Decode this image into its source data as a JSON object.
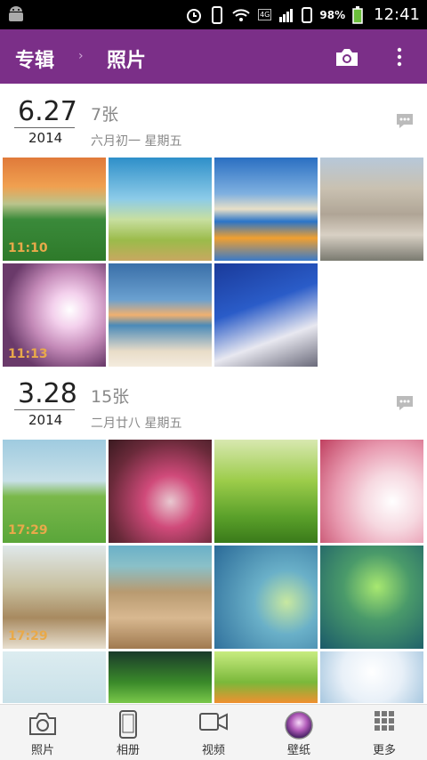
{
  "status": {
    "battery": "98%",
    "time": "12:41",
    "network": "4G"
  },
  "appbar": {
    "crumb_albums": "专辑",
    "separator": "›",
    "crumb_photos": "照片"
  },
  "sections": [
    {
      "date": "6.27",
      "year": "2014",
      "count": "7张",
      "lunar": "六月初一  星期五",
      "thumbs": [
        {
          "time": "11:10"
        },
        {
          "time": ""
        },
        {
          "time": ""
        },
        {
          "time": ""
        },
        {
          "time": "11:13"
        },
        {
          "time": ""
        },
        {
          "time": ""
        }
      ]
    },
    {
      "date": "3.28",
      "year": "2014",
      "count": "15张",
      "lunar": "二月廿八  星期五",
      "thumbs": [
        {
          "time": "17:29"
        },
        {
          "time": ""
        },
        {
          "time": ""
        },
        {
          "time": ""
        },
        {
          "time": "17:29"
        },
        {
          "time": ""
        },
        {
          "time": ""
        },
        {
          "time": ""
        },
        {
          "time": ""
        },
        {
          "time": ""
        },
        {
          "time": ""
        },
        {
          "time": ""
        }
      ]
    }
  ],
  "tabs": [
    {
      "label": "照片",
      "icon": "camera-icon"
    },
    {
      "label": "相册",
      "icon": "phone-icon"
    },
    {
      "label": "视频",
      "icon": "video-icon"
    },
    {
      "label": "壁纸",
      "icon": "wallpaper-icon"
    },
    {
      "label": "更多",
      "icon": "grid-icon"
    }
  ],
  "colors": {
    "appbar": "#7b2f88",
    "timestamp": "#e8a94a"
  }
}
